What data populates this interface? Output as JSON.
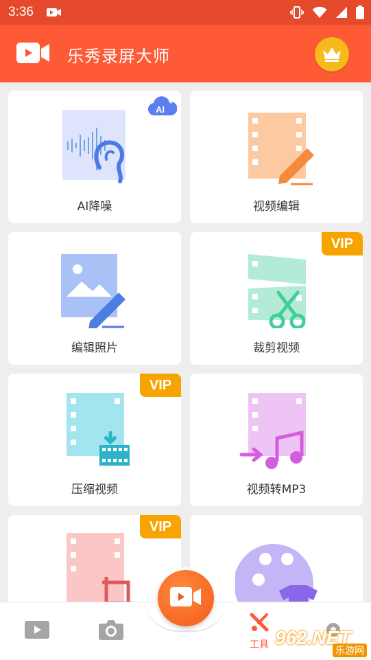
{
  "status_bar": {
    "time": "3:36"
  },
  "app_bar": {
    "title": "乐秀录屏大师"
  },
  "tools": [
    {
      "label": "AI降噪",
      "badge": "AI"
    },
    {
      "label": "视频编辑"
    },
    {
      "label": "编辑照片"
    },
    {
      "label": "裁剪视频",
      "badge": "VIP"
    },
    {
      "label": "压缩视频",
      "badge": "VIP"
    },
    {
      "label": "视频转MP3"
    },
    {
      "badge": "VIP"
    },
    {}
  ],
  "bottom_nav": {
    "tools_label": "工具"
  },
  "watermark": {
    "num": "962.NET",
    "cn": "乐游网"
  },
  "colors": {
    "accent": "#fe5a36",
    "status": "#e64a2c",
    "vip": "#f7a400"
  }
}
